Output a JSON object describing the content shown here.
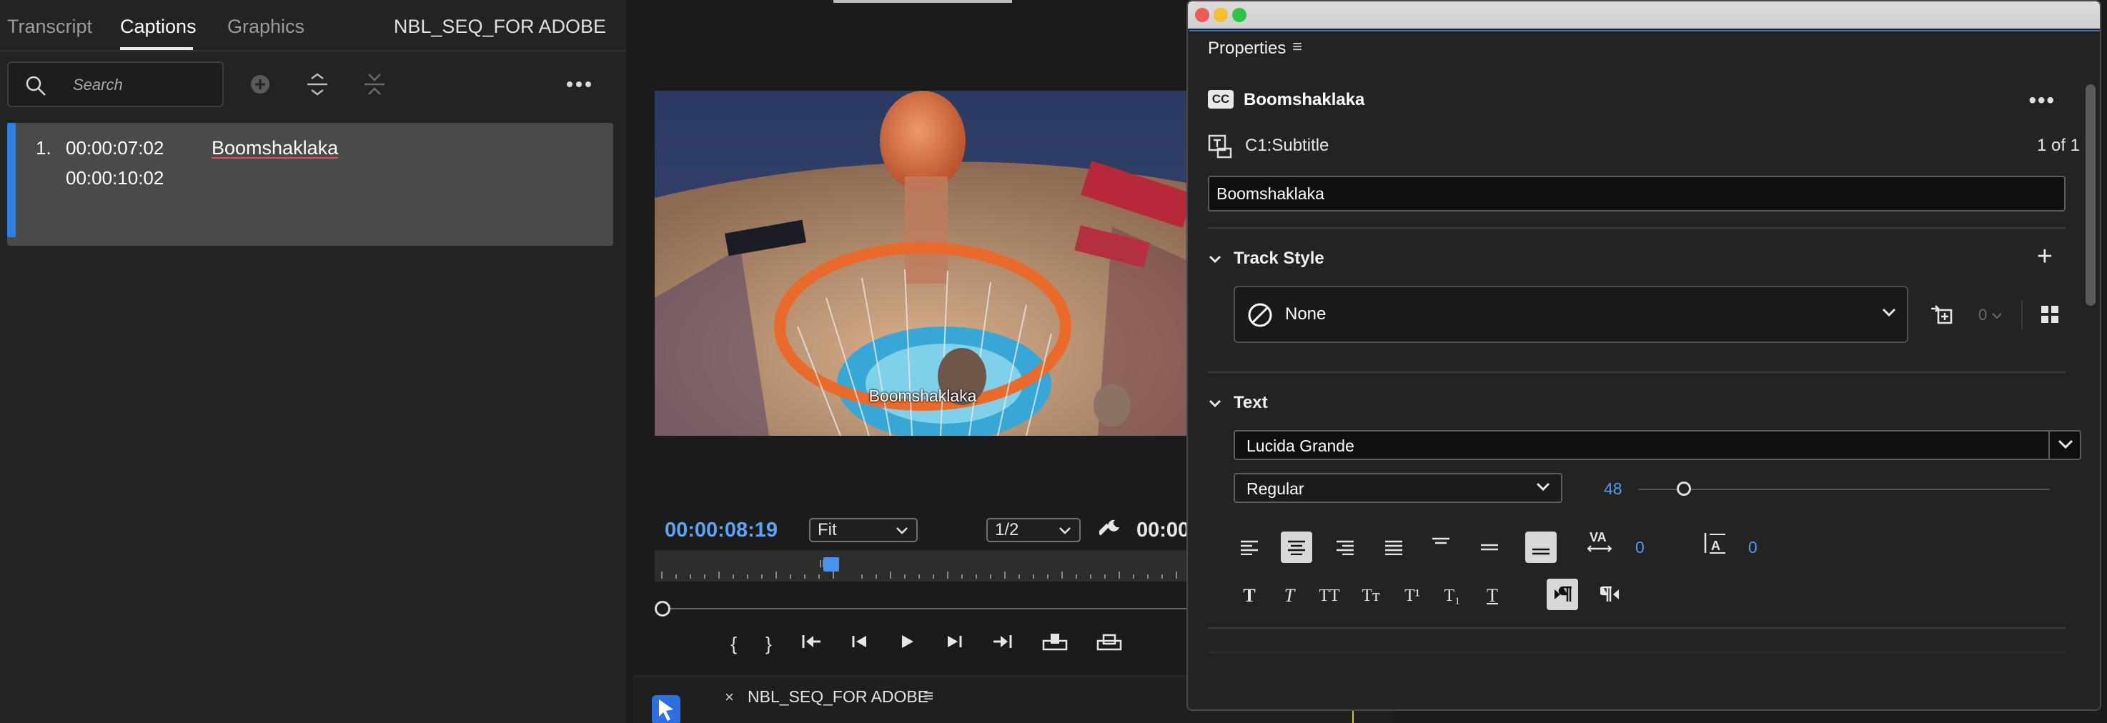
{
  "captions_panel": {
    "tabs": [
      {
        "label": "Transcript",
        "active": false
      },
      {
        "label": "Captions",
        "active": true
      },
      {
        "label": "Graphics",
        "active": false
      }
    ],
    "sequence_name": "NBL_SEQ_FOR ADOBE",
    "search": {
      "placeholder": "Search",
      "value": ""
    },
    "tools": [
      "add-caption-icon",
      "merge-captions-icon",
      "split-caption-icon",
      "more-options-icon"
    ],
    "items": [
      {
        "index": "1.",
        "time_in": "00:00:07:02",
        "time_out": "00:00:10:02",
        "text": "Boomshaklaka",
        "selected": true
      }
    ]
  },
  "program_monitor": {
    "subtitle_overlay": "Boomshaklaka",
    "current_time": "00:00:08:19",
    "zoom": "Fit",
    "resolution": "1/2",
    "duration_partial": "00:00",
    "transport": [
      "{",
      "}",
      "go-to-in-icon",
      "step-back-icon",
      "play-icon",
      "step-forward-icon",
      "go-to-out-icon",
      "insert-icon",
      "overwrite-icon"
    ]
  },
  "timeline": {
    "close": "×",
    "sequence_name": "NBL_SEQ_FOR ADOBE",
    "menu": "≡"
  },
  "properties": {
    "title": "Properties",
    "menu": "≡",
    "clip_badge": "CC",
    "clip_name": "Boomshaklaka",
    "more": "•••",
    "track_name": "C1:Subtitle",
    "track_count": "1 of 1",
    "caption_text": "Boomshaklaka",
    "track_style": {
      "section_label": "Track Style",
      "selected": "None",
      "sync_count": "0"
    },
    "text": {
      "section_label": "Text",
      "font": "Lucida Grande",
      "weight": "Regular",
      "size": "48",
      "size_slider_fraction": 0.1,
      "kerning": "0",
      "leading": "0",
      "selected_alignment": "center",
      "case_buttons": [
        "T",
        "T",
        "TT",
        "Tт",
        "T¹",
        "T₁",
        "T"
      ]
    },
    "colors": {
      "accent": "#4f9bf0",
      "caption_bar": "#2f7fe7",
      "titlebar_close": "#ee5b55",
      "titlebar_min": "#f4be2c",
      "titlebar_max": "#2fc443"
    }
  }
}
